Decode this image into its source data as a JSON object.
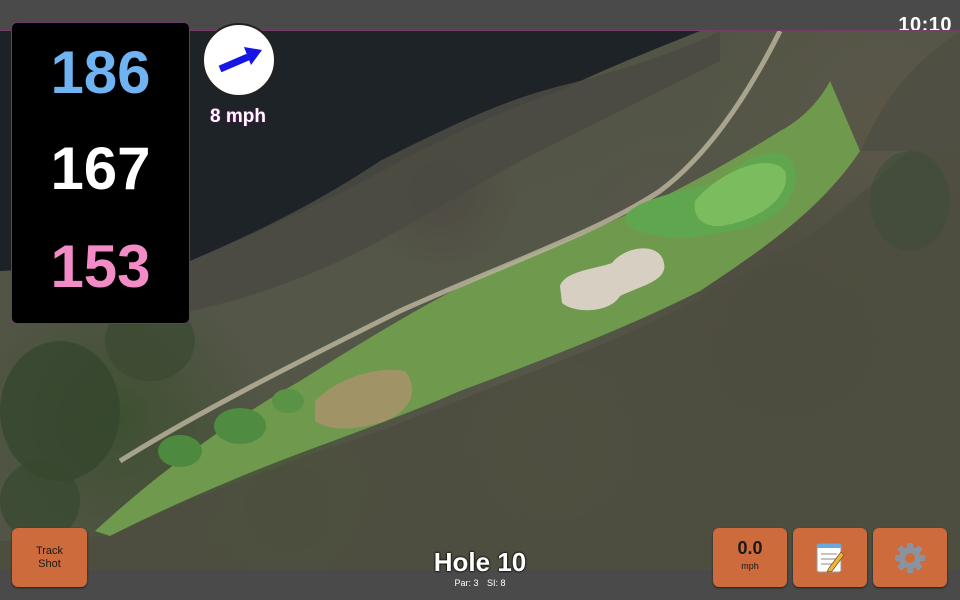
{
  "status": {
    "time": "10:10"
  },
  "yardages": {
    "back": "186",
    "middle": "167",
    "front": "153"
  },
  "wind": {
    "speed_label": "8 mph",
    "direction_icon": "arrow-east-icon",
    "arrow_color": "#1515e6"
  },
  "hole": {
    "title": "Hole 10",
    "par_label": "Par: 3",
    "si_label": "SI: 8"
  },
  "buttons": {
    "track_shot_line1": "Track",
    "track_shot_line2": "Shot",
    "speed_value": "0.0",
    "speed_unit": "mph",
    "notes_icon": "notepad-icon",
    "settings_icon": "gear-icon"
  },
  "colors": {
    "back_yardage": "#6fb3f2",
    "middle_yardage": "#ffffff",
    "front_yardage": "#f38cc6",
    "button_bg": "#cd6b3d",
    "fairway": "#6f9a4e",
    "green": "#5fa64e"
  }
}
